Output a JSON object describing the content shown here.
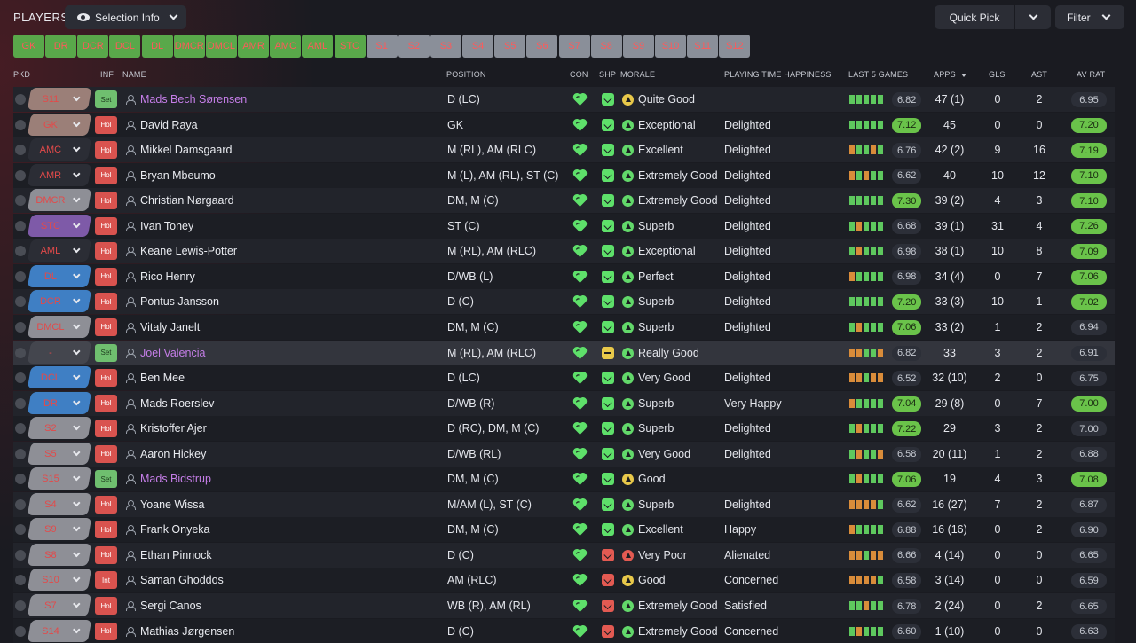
{
  "header": {
    "title": "PLAYERS",
    "selection_info_label": "Selection Info",
    "quick_pick_label": "Quick Pick",
    "filter_label": "Filter"
  },
  "chips": [
    "GK",
    "DR",
    "DCR",
    "DCL",
    "DL",
    "DMCR",
    "DMCL",
    "AMR",
    "AMC",
    "AML",
    "STC",
    "S1",
    "S2",
    "S3",
    "S4",
    "S5",
    "S6",
    "S7",
    "S8",
    "S9",
    "S10",
    "S11",
    "S12"
  ],
  "columns": {
    "pkd": "PKD",
    "inf": "INF",
    "name": "NAME",
    "position": "POSITION",
    "con": "CON",
    "shp": "SHP",
    "morale": "MORALE",
    "happiness": "PLAYING TIME HAPPINESS",
    "last5": "LAST 5 GAMES",
    "apps": "APPS",
    "gls": "GLS",
    "ast": "AST",
    "avrat": "AV RAT"
  },
  "colors": {
    "chip_position": "#59a84a",
    "chip_sub": "#8a8f99",
    "accent_green": "#6ac34a",
    "accent_red": "#e35a52",
    "name_purple": "#c57ee8"
  },
  "players": [
    {
      "pkd": "S11",
      "pkd_color": "#9b7f78",
      "inf": "Set",
      "name": "Mads Bech Sørensen",
      "purple": true,
      "position": "D (LC)",
      "shp": "g",
      "mood": "y",
      "morale": "Quite Good",
      "happiness": "",
      "last5": [
        "g",
        "g",
        "g",
        "g",
        "g"
      ],
      "last_rating": "6.82",
      "last_hl": false,
      "apps": "47 (1)",
      "gls": "0",
      "ast": "2",
      "avrat": "6.95",
      "avr_hl": false
    },
    {
      "pkd": "GK",
      "pkd_color": "#9b7f78",
      "inf": "Hol",
      "name": "David Raya",
      "purple": false,
      "position": "GK",
      "shp": "g",
      "mood": "g",
      "morale": "Exceptional",
      "happiness": "Delighted",
      "last5": [
        "g",
        "g",
        "g",
        "g",
        "g"
      ],
      "last_rating": "7.12",
      "last_hl": true,
      "apps": "45",
      "gls": "0",
      "ast": "0",
      "avrat": "7.20",
      "avr_hl": true
    },
    {
      "pkd": "AMC",
      "pkd_color": "#2b2d35",
      "inf": "Hol",
      "name": "Mikkel Damsgaard",
      "purple": false,
      "position": "M (RL), AM (RLC)",
      "shp": "g",
      "mood": "g",
      "morale": "Excellent",
      "happiness": "Delighted",
      "last5": [
        "o",
        "g",
        "g",
        "o",
        "g"
      ],
      "last_rating": "6.76",
      "last_hl": false,
      "apps": "42 (2)",
      "gls": "9",
      "ast": "16",
      "avrat": "7.19",
      "avr_hl": true
    },
    {
      "pkd": "AMR",
      "pkd_color": "#2b2d35",
      "inf": "Hol",
      "name": "Bryan Mbeumo",
      "purple": false,
      "position": "M (L), AM (RL), ST (C)",
      "shp": "g",
      "mood": "g",
      "morale": "Extremely Good",
      "happiness": "Delighted",
      "last5": [
        "o",
        "g",
        "o",
        "g",
        "g"
      ],
      "last_rating": "6.62",
      "last_hl": false,
      "apps": "40",
      "gls": "10",
      "ast": "12",
      "avrat": "7.10",
      "avr_hl": true
    },
    {
      "pkd": "DMCR",
      "pkd_color": "#8e8f96",
      "inf": "Hol",
      "name": "Christian Nørgaard",
      "purple": false,
      "position": "DM, M (C)",
      "shp": "g",
      "mood": "g",
      "morale": "Extremely Good",
      "happiness": "Delighted",
      "last5": [
        "g",
        "g",
        "g",
        "g",
        "g"
      ],
      "last_rating": "7.30",
      "last_hl": true,
      "apps": "39 (2)",
      "gls": "4",
      "ast": "3",
      "avrat": "7.10",
      "avr_hl": true
    },
    {
      "pkd": "STC",
      "pkd_color": "#7e5aa8",
      "inf": "Hol",
      "name": "Ivan Toney",
      "purple": false,
      "position": "ST (C)",
      "shp": "g",
      "mood": "g",
      "morale": "Superb",
      "happiness": "Delighted",
      "last5": [
        "g",
        "o",
        "g",
        "g",
        "g"
      ],
      "last_rating": "6.68",
      "last_hl": false,
      "apps": "39 (1)",
      "gls": "31",
      "ast": "4",
      "avrat": "7.26",
      "avr_hl": true
    },
    {
      "pkd": "AML",
      "pkd_color": "#2b2d35",
      "inf": "Hol",
      "name": "Keane Lewis-Potter",
      "purple": false,
      "position": "M (RL), AM (RLC)",
      "shp": "g",
      "mood": "g",
      "morale": "Exceptional",
      "happiness": "Delighted",
      "last5": [
        "g",
        "o",
        "g",
        "g",
        "g"
      ],
      "last_rating": "6.98",
      "last_hl": false,
      "apps": "38 (1)",
      "gls": "10",
      "ast": "8",
      "avrat": "7.09",
      "avr_hl": true
    },
    {
      "pkd": "DL",
      "pkd_color": "#3f7fc4",
      "inf": "Hol",
      "name": "Rico Henry",
      "purple": false,
      "position": "D/WB (L)",
      "shp": "g",
      "mood": "g",
      "morale": "Perfect",
      "happiness": "Delighted",
      "last5": [
        "o",
        "g",
        "g",
        "g",
        "g"
      ],
      "last_rating": "6.98",
      "last_hl": false,
      "apps": "34 (4)",
      "gls": "0",
      "ast": "7",
      "avrat": "7.06",
      "avr_hl": true
    },
    {
      "pkd": "DCR",
      "pkd_color": "#3f7fc4",
      "inf": "Hol",
      "name": "Pontus Jansson",
      "purple": false,
      "position": "D (C)",
      "shp": "g",
      "mood": "g",
      "morale": "Superb",
      "happiness": "Delighted",
      "last5": [
        "g",
        "g",
        "g",
        "g",
        "g"
      ],
      "last_rating": "7.20",
      "last_hl": true,
      "apps": "33 (3)",
      "gls": "10",
      "ast": "1",
      "avrat": "7.02",
      "avr_hl": true
    },
    {
      "pkd": "DMCL",
      "pkd_color": "#8e8f96",
      "inf": "Hol",
      "name": "Vitaly Janelt",
      "purple": false,
      "position": "DM, M (C)",
      "shp": "g",
      "mood": "g",
      "morale": "Superb",
      "happiness": "Delighted",
      "last5": [
        "g",
        "o",
        "g",
        "g",
        "g"
      ],
      "last_rating": "7.06",
      "last_hl": true,
      "apps": "33 (2)",
      "gls": "1",
      "ast": "2",
      "avrat": "6.94",
      "avr_hl": false
    },
    {
      "pkd": "-",
      "pkd_color": "#44464e",
      "inf": "Set",
      "name": "Joel Valencia",
      "purple": true,
      "position": "M (RL), AM (RLC)",
      "shp": "y",
      "mood": "g",
      "morale": "Really Good",
      "happiness": "",
      "last5": [
        "o",
        "o",
        "g",
        "g",
        "o"
      ],
      "last_rating": "6.82",
      "last_hl": false,
      "apps": "33",
      "gls": "3",
      "ast": "2",
      "avrat": "6.91",
      "avr_hl": false
    },
    {
      "pkd": "DCL",
      "pkd_color": "#3f7fc4",
      "inf": "Hol",
      "name": "Ben Mee",
      "purple": false,
      "position": "D (LC)",
      "shp": "g",
      "mood": "g",
      "morale": "Very Good",
      "happiness": "Delighted",
      "last5": [
        "o",
        "o",
        "g",
        "o",
        "o"
      ],
      "last_rating": "6.52",
      "last_hl": false,
      "apps": "32 (10)",
      "gls": "2",
      "ast": "0",
      "avrat": "6.75",
      "avr_hl": false
    },
    {
      "pkd": "DR",
      "pkd_color": "#3f7fc4",
      "inf": "Hol",
      "name": "Mads Roerslev",
      "purple": false,
      "position": "D/WB (R)",
      "shp": "g",
      "mood": "g",
      "morale": "Superb",
      "happiness": "Very Happy",
      "last5": [
        "o",
        "g",
        "g",
        "g",
        "g"
      ],
      "last_rating": "7.04",
      "last_hl": true,
      "apps": "29 (8)",
      "gls": "0",
      "ast": "7",
      "avrat": "7.00",
      "avr_hl": true
    },
    {
      "pkd": "S2",
      "pkd_color": "#8e8f96",
      "inf": "Hol",
      "name": "Kristoffer Ajer",
      "purple": false,
      "position": "D (RC), DM, M (C)",
      "shp": "g",
      "mood": "g",
      "morale": "Superb",
      "happiness": "Delighted",
      "last5": [
        "g",
        "o",
        "g",
        "g",
        "g"
      ],
      "last_rating": "7.22",
      "last_hl": true,
      "apps": "29",
      "gls": "3",
      "ast": "2",
      "avrat": "7.00",
      "avr_hl": false
    },
    {
      "pkd": "S5",
      "pkd_color": "#8e8f96",
      "inf": "Hol",
      "name": "Aaron Hickey",
      "purple": false,
      "position": "D/WB (RL)",
      "shp": "g",
      "mood": "g",
      "morale": "Very Good",
      "happiness": "Delighted",
      "last5": [
        "g",
        "o",
        "g",
        "g",
        "o"
      ],
      "last_rating": "6.58",
      "last_hl": false,
      "apps": "20 (11)",
      "gls": "1",
      "ast": "2",
      "avrat": "6.88",
      "avr_hl": false
    },
    {
      "pkd": "S15",
      "pkd_color": "#8e8f96",
      "inf": "Set",
      "name": "Mads Bidstrup",
      "purple": true,
      "position": "DM, M (C)",
      "shp": "g",
      "mood": "y",
      "morale": "Good",
      "happiness": "",
      "last5": [
        "g",
        "o",
        "g",
        "g",
        "g"
      ],
      "last_rating": "7.06",
      "last_hl": true,
      "apps": "19",
      "gls": "4",
      "ast": "3",
      "avrat": "7.08",
      "avr_hl": true
    },
    {
      "pkd": "S4",
      "pkd_color": "#8e8f96",
      "inf": "Hol",
      "name": "Yoane Wissa",
      "purple": false,
      "position": "M/AM (L), ST (C)",
      "shp": "g",
      "mood": "g",
      "morale": "Superb",
      "happiness": "Delighted",
      "last5": [
        "o",
        "o",
        "o",
        "o",
        "g"
      ],
      "last_rating": "6.62",
      "last_hl": false,
      "apps": "16 (27)",
      "gls": "7",
      "ast": "2",
      "avrat": "6.87",
      "avr_hl": false
    },
    {
      "pkd": "S9",
      "pkd_color": "#8e8f96",
      "inf": "Hol",
      "name": "Frank Onyeka",
      "purple": false,
      "position": "DM, M (C)",
      "shp": "g",
      "mood": "g",
      "morale": "Excellent",
      "happiness": "Happy",
      "last5": [
        "o",
        "g",
        "g",
        "g",
        "g"
      ],
      "last_rating": "6.88",
      "last_hl": false,
      "apps": "16 (16)",
      "gls": "0",
      "ast": "2",
      "avrat": "6.90",
      "avr_hl": false
    },
    {
      "pkd": "S8",
      "pkd_color": "#8e8f96",
      "inf": "Hol",
      "name": "Ethan Pinnock",
      "purple": false,
      "position": "D (C)",
      "shp": "r",
      "mood": "r",
      "morale": "Very Poor",
      "happiness": "Alienated",
      "last5": [
        "o",
        "o",
        "g",
        "o",
        "o"
      ],
      "last_rating": "6.66",
      "last_hl": false,
      "apps": "4 (14)",
      "gls": "0",
      "ast": "0",
      "avrat": "6.65",
      "avr_hl": false
    },
    {
      "pkd": "S10",
      "pkd_color": "#8e8f96",
      "inf": "Int",
      "name": "Saman Ghoddos",
      "purple": false,
      "position": "AM (RLC)",
      "shp": "r",
      "mood": "y",
      "morale": "Good",
      "happiness": "Concerned",
      "last5": [
        "o",
        "o",
        "o",
        "o",
        "g"
      ],
      "last_rating": "6.58",
      "last_hl": false,
      "apps": "3 (14)",
      "gls": "0",
      "ast": "0",
      "avrat": "6.59",
      "avr_hl": false
    },
    {
      "pkd": "S7",
      "pkd_color": "#8e8f96",
      "inf": "Hol",
      "name": "Sergi Canos",
      "purple": false,
      "position": "WB (R), AM (RL)",
      "shp": "r",
      "mood": "g",
      "morale": "Extremely Good",
      "happiness": "Satisfied",
      "last5": [
        "g",
        "g",
        "o",
        "g",
        "g"
      ],
      "last_rating": "6.78",
      "last_hl": false,
      "apps": "2 (24)",
      "gls": "0",
      "ast": "2",
      "avrat": "6.65",
      "avr_hl": false
    },
    {
      "pkd": "S14",
      "pkd_color": "#8e8f96",
      "inf": "Hol",
      "name": "Mathias Jørgensen",
      "purple": false,
      "position": "D (C)",
      "shp": "r",
      "mood": "g",
      "morale": "Extremely Good",
      "happiness": "Concerned",
      "last5": [
        "g",
        "o",
        "g",
        "g",
        "g"
      ],
      "last_rating": "6.60",
      "last_hl": false,
      "apps": "1 (10)",
      "gls": "0",
      "ast": "0",
      "avrat": "6.63",
      "avr_hl": false
    }
  ]
}
